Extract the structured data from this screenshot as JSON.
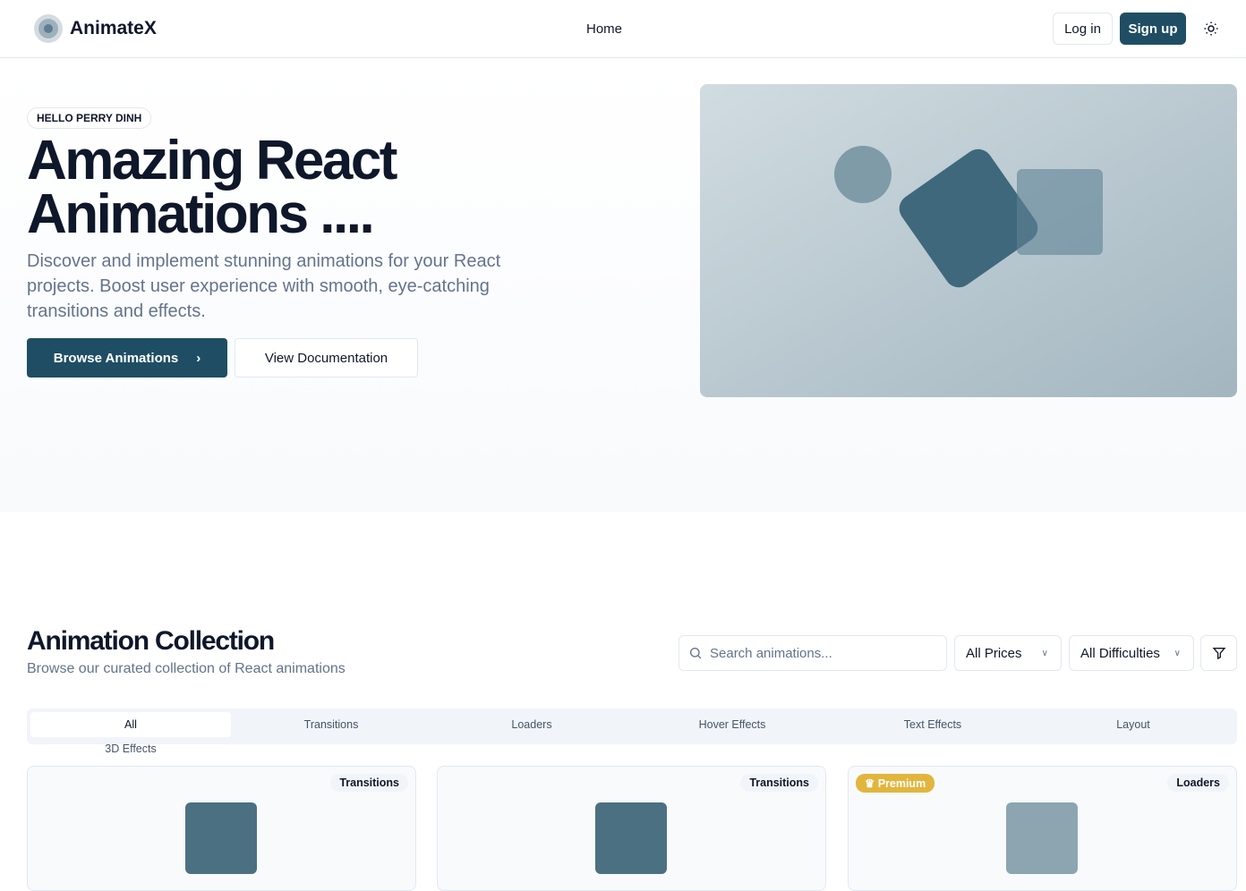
{
  "header": {
    "brand": "AnimateX",
    "nav": [
      "Home"
    ],
    "login": "Log in",
    "signup": "Sign up",
    "theme_icon": "sun-icon"
  },
  "hero": {
    "badge": "HELLO PERRY DINH",
    "title": "Amazing React Animations ....",
    "subtitle": "Discover and implement stunning animations for your React projects. Boost user experience with smooth, eye-catching transitions and effects.",
    "browse": "Browse Animations",
    "docs": "View Documentation"
  },
  "collection": {
    "title": "Animation Collection",
    "subtitle": "Browse our curated collection of React animations",
    "search_placeholder": "Search animations...",
    "price_filter": "All Prices",
    "difficulty_filter": "All Difficulties",
    "tabs": [
      "All",
      "Transitions",
      "Loaders",
      "Hover Effects",
      "Text Effects",
      "Layout",
      "3D Effects"
    ],
    "cards": [
      {
        "category": "Transitions",
        "premium": null,
        "preview_color": "#4b7082"
      },
      {
        "category": "Transitions",
        "premium": null,
        "preview_color": "#4b7082"
      },
      {
        "category": "Loaders",
        "premium": "Premium",
        "preview_color": "#8da5b0"
      }
    ]
  },
  "colors": {
    "primary": "#1f4e64",
    "premium": "#e2b53e"
  }
}
